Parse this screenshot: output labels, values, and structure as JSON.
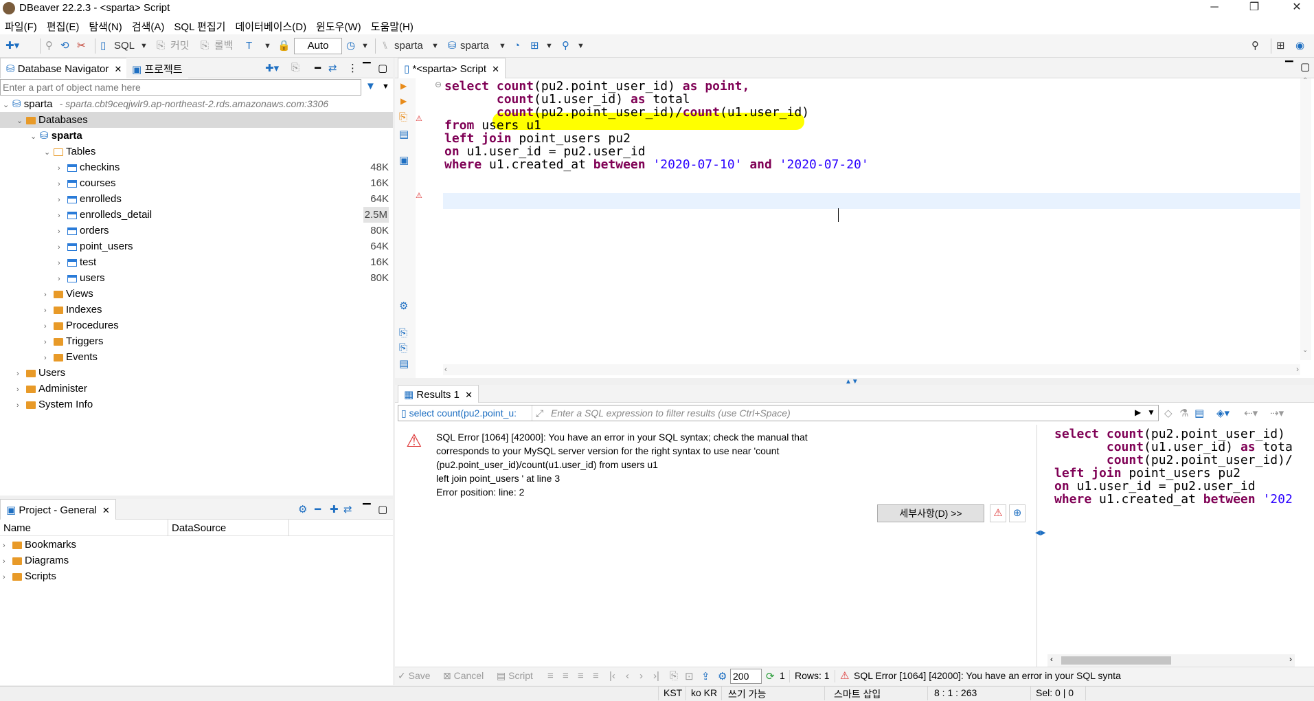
{
  "window": {
    "title": "DBeaver 22.2.3 - <sparta> Script"
  },
  "menu": [
    "파일(F)",
    "편집(E)",
    "탐색(N)",
    "검색(A)",
    "SQL 편집기",
    "데이터베이스(D)",
    "윈도우(W)",
    "도움말(H)"
  ],
  "toolbar": {
    "sql_label": "SQL",
    "commit_label": "커밋",
    "rollback_label": "롤백",
    "auto_label": "Auto",
    "datasource_label": "sparta",
    "schema_label": "sparta"
  },
  "navigator": {
    "tab_label": "Database Navigator",
    "tab2_label": "프로젝트",
    "filter_placeholder": "Enter a part of object name here",
    "connection": {
      "name": "sparta",
      "host": "- sparta.cbt9ceqjwlr9.ap-northeast-2.rds.amazonaws.com:3306"
    },
    "databases_label": "Databases",
    "schema": "sparta",
    "tables_label": "Tables",
    "tables": [
      {
        "name": "checkins",
        "size": "48K"
      },
      {
        "name": "courses",
        "size": "16K"
      },
      {
        "name": "enrolleds",
        "size": "64K"
      },
      {
        "name": "enrolleds_detail",
        "size": "2.5M"
      },
      {
        "name": "orders",
        "size": "80K"
      },
      {
        "name": "point_users",
        "size": "64K"
      },
      {
        "name": "test",
        "size": "16K"
      },
      {
        "name": "users",
        "size": "80K"
      }
    ],
    "folders": [
      "Views",
      "Indexes",
      "Procedures",
      "Triggers",
      "Events"
    ],
    "root_items": [
      "Users",
      "Administer",
      "System Info"
    ]
  },
  "project": {
    "tab_label": "Project - General",
    "col_name": "Name",
    "col_datasource": "DataSource",
    "items": [
      "Bookmarks",
      "Diagrams",
      "Scripts"
    ]
  },
  "editor": {
    "tab_label": "*<sparta> Script",
    "lines": [
      [
        {
          "t": "select ",
          "k": "kw"
        },
        {
          "t": "count",
          "k": "kw"
        },
        {
          "t": "(pu2.point_user_id) ",
          "k": ""
        },
        {
          "t": "as ",
          "k": "kw"
        },
        {
          "t": "point,",
          "k": "kw"
        }
      ],
      [
        {
          "t": "       ",
          "k": ""
        },
        {
          "t": "count",
          "k": "kw"
        },
        {
          "t": "(u1.user_id) ",
          "k": ""
        },
        {
          "t": "as ",
          "k": "kw"
        },
        {
          "t": "total",
          "k": ""
        }
      ],
      [
        {
          "t": "       ",
          "k": ""
        },
        {
          "t": "count",
          "k": "kw"
        },
        {
          "t": "(pu2.point_user_id)/",
          "k": ""
        },
        {
          "t": "count",
          "k": "kw"
        },
        {
          "t": "(u1.user_id)",
          "k": ""
        }
      ],
      [
        {
          "t": "from ",
          "k": "kw"
        },
        {
          "t": "users u1",
          "k": ""
        }
      ],
      [
        {
          "t": "left ",
          "k": "kw"
        },
        {
          "t": "join ",
          "k": "kw"
        },
        {
          "t": "point_users pu2",
          "k": ""
        }
      ],
      [
        {
          "t": "on ",
          "k": "kw"
        },
        {
          "t": "u1.user_id = pu2.user_id",
          "k": ""
        }
      ],
      [
        {
          "t": "where ",
          "k": "kw"
        },
        {
          "t": "u1.created_at ",
          "k": ""
        },
        {
          "t": "between ",
          "k": "kw"
        },
        {
          "t": "'2020-07-10'",
          "k": "str"
        },
        {
          "t": " and ",
          "k": "kw"
        },
        {
          "t": "'2020-07-20'",
          "k": "str"
        }
      ]
    ]
  },
  "results": {
    "tab_label": "Results 1",
    "query_preview": "select count(pu2.point_u:",
    "filter_placeholder": "Enter a SQL expression to filter results (use Ctrl+Space)",
    "error_lines": [
      "SQL Error [1064] [42000]: You have an error in your SQL syntax; check the manual that",
      "corresponds to your MySQL server version for the right syntax to use near 'count",
      "(pu2.point_user_id)/count(u1.user_id) from users u1",
      "left join point_users ' at line 3",
      "Error position: line: 2"
    ],
    "details_button": "세부사항(D) >>",
    "side_lines": [
      [
        {
          "t": "select ",
          "k": "kw"
        },
        {
          "t": "count",
          "k": "kw"
        },
        {
          "t": "(pu2.point_user_id)",
          "k": ""
        }
      ],
      [
        {
          "t": "       ",
          "k": ""
        },
        {
          "t": "count",
          "k": "kw"
        },
        {
          "t": "(u1.user_id) ",
          "k": ""
        },
        {
          "t": "as ",
          "k": "kw"
        },
        {
          "t": "tota",
          "k": ""
        }
      ],
      [
        {
          "t": "       ",
          "k": ""
        },
        {
          "t": "count",
          "k": "kw"
        },
        {
          "t": "(pu2.point_user_id)/",
          "k": ""
        }
      ],
      [
        {
          "t": "left ",
          "k": "kw"
        },
        {
          "t": "join ",
          "k": "kw"
        },
        {
          "t": "point_users pu2",
          "k": ""
        }
      ],
      [
        {
          "t": "on ",
          "k": "kw"
        },
        {
          "t": "u1.user_id = pu2.user_id",
          "k": ""
        }
      ],
      [
        {
          "t": "where ",
          "k": "kw"
        },
        {
          "t": "u1.created_at ",
          "k": ""
        },
        {
          "t": "between ",
          "k": "kw"
        },
        {
          "t": "'202",
          "k": "str"
        }
      ]
    ],
    "footer": {
      "save": "Save",
      "cancel": "Cancel",
      "script": "Script",
      "fetch_size": "200",
      "refresh_count": "1",
      "rows": "Rows: 1",
      "error": "SQL Error [1064] [42000]: You have an error in your SQL synta"
    }
  },
  "statusbar": {
    "tz": "KST",
    "locale": "ko KR",
    "mode": "쓰기 가능",
    "insert": "스마트 삽입",
    "position": "8 : 1 : 263",
    "selection": "Sel: 0 | 0"
  },
  "colors": {
    "keyword": "#7f0055",
    "string": "#2a00ff",
    "highlight": "#ffff00",
    "selected_row": "#d9d9d9"
  }
}
